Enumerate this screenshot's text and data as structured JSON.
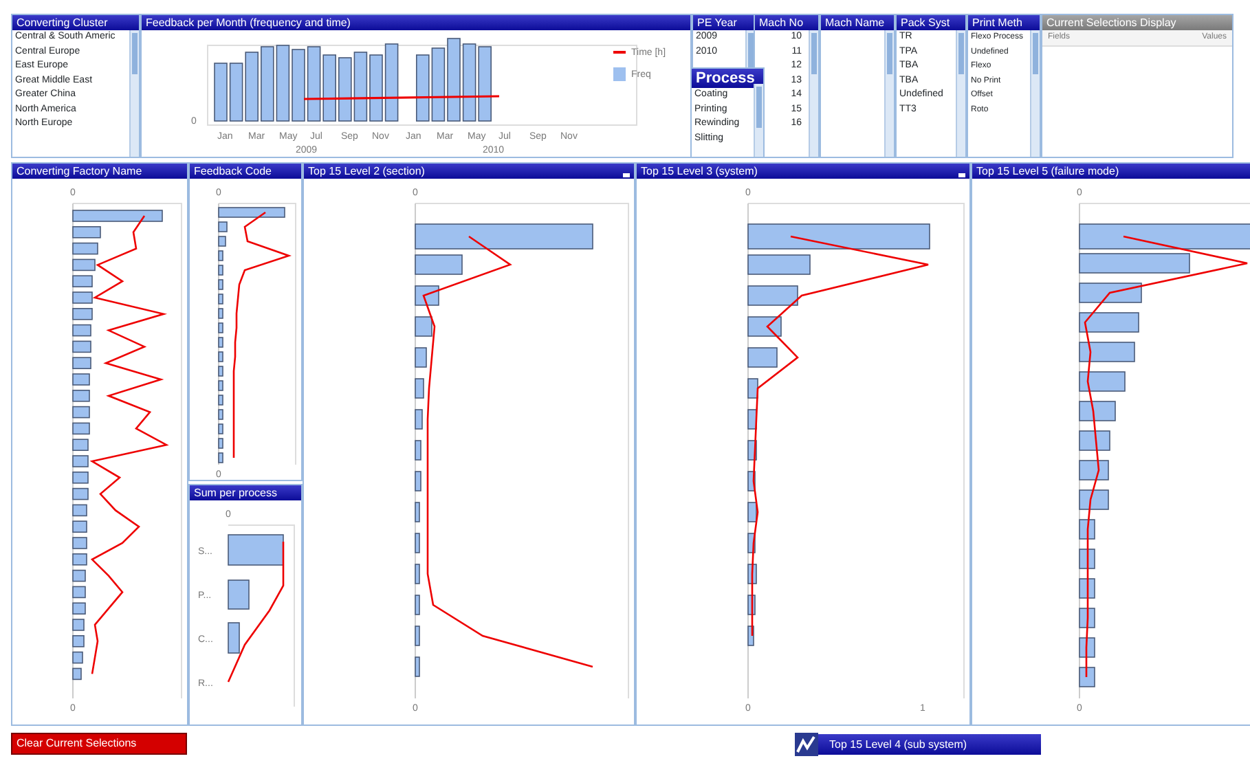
{
  "cluster_list": {
    "title": "Converting Cluster",
    "items": [
      "Central & South Americ",
      "Central Europe",
      "East Europe",
      "Great Middle East",
      "Greater China",
      "North America",
      "North Europe"
    ]
  },
  "monthly_chart": {
    "title": "Feedback per Month (frequency and time)",
    "y_tick": "0",
    "months": [
      "Jan",
      "Mar",
      "May",
      "Jul",
      "Sep",
      "Nov",
      "Jan",
      "Mar",
      "May",
      "Jul",
      "Sep",
      "Nov"
    ],
    "years": [
      "2009",
      "2010"
    ],
    "legend": [
      {
        "label": "Time [h]",
        "kind": "line"
      },
      {
        "label": "Freq",
        "kind": "bar"
      }
    ]
  },
  "list_boxes": [
    {
      "title": "PE Year",
      "items": [
        "2009",
        "2010"
      ]
    },
    {
      "title": "Mach No",
      "items": [
        "10",
        "11",
        "12",
        "13",
        "14",
        "15",
        "16"
      ]
    },
    {
      "title": "Mach Name"
    },
    {
      "title": "Pack Syst",
      "items": [
        "TR",
        "TPA",
        "TBA",
        "TBA",
        "Undefined",
        "TT3"
      ]
    },
    {
      "title": "Print Meth",
      "items": [
        "Flexo Process",
        "Undefined",
        "Flexo",
        "No Print",
        "Offset",
        "Roto"
      ]
    }
  ],
  "process_list": {
    "title": "Process",
    "items": [
      "Coating",
      "Printing",
      "Rewinding",
      "Slitting"
    ]
  },
  "current_selections": {
    "title": "Current Selections Display",
    "columns": [
      "Fields",
      "Values"
    ]
  },
  "charts": [
    {
      "title": "Converting Factory Name",
      "top_tick": "0",
      "bottom_ticks": [
        "0"
      ],
      "minimizable": false
    },
    {
      "title": "Feedback Code",
      "top_tick": "0",
      "bottom_ticks": [
        "0"
      ],
      "minimizable": false
    },
    {
      "title": "Top 15 Level 2 (section)",
      "top_tick": "0",
      "bottom_ticks": [
        "0"
      ],
      "minimizable": true
    },
    {
      "title": "Top 15 Level 3 (system)",
      "top_tick": "0",
      "bottom_ticks": [
        "0",
        "1"
      ],
      "minimizable": true
    },
    {
      "title": "Top 15 Level 5 (failure mode)",
      "top_tick": "0",
      "bottom_ticks": [
        "0"
      ],
      "minimizable": false
    }
  ],
  "sum_per_process": {
    "title": "Sum per process",
    "top_tick": "0",
    "categories": [
      "S...",
      "P...",
      "C...",
      "R..."
    ]
  },
  "clear_button": "Clear Current Selections",
  "minimized_chart": {
    "title": "Top 15 Level 4 (sub system)"
  }
}
